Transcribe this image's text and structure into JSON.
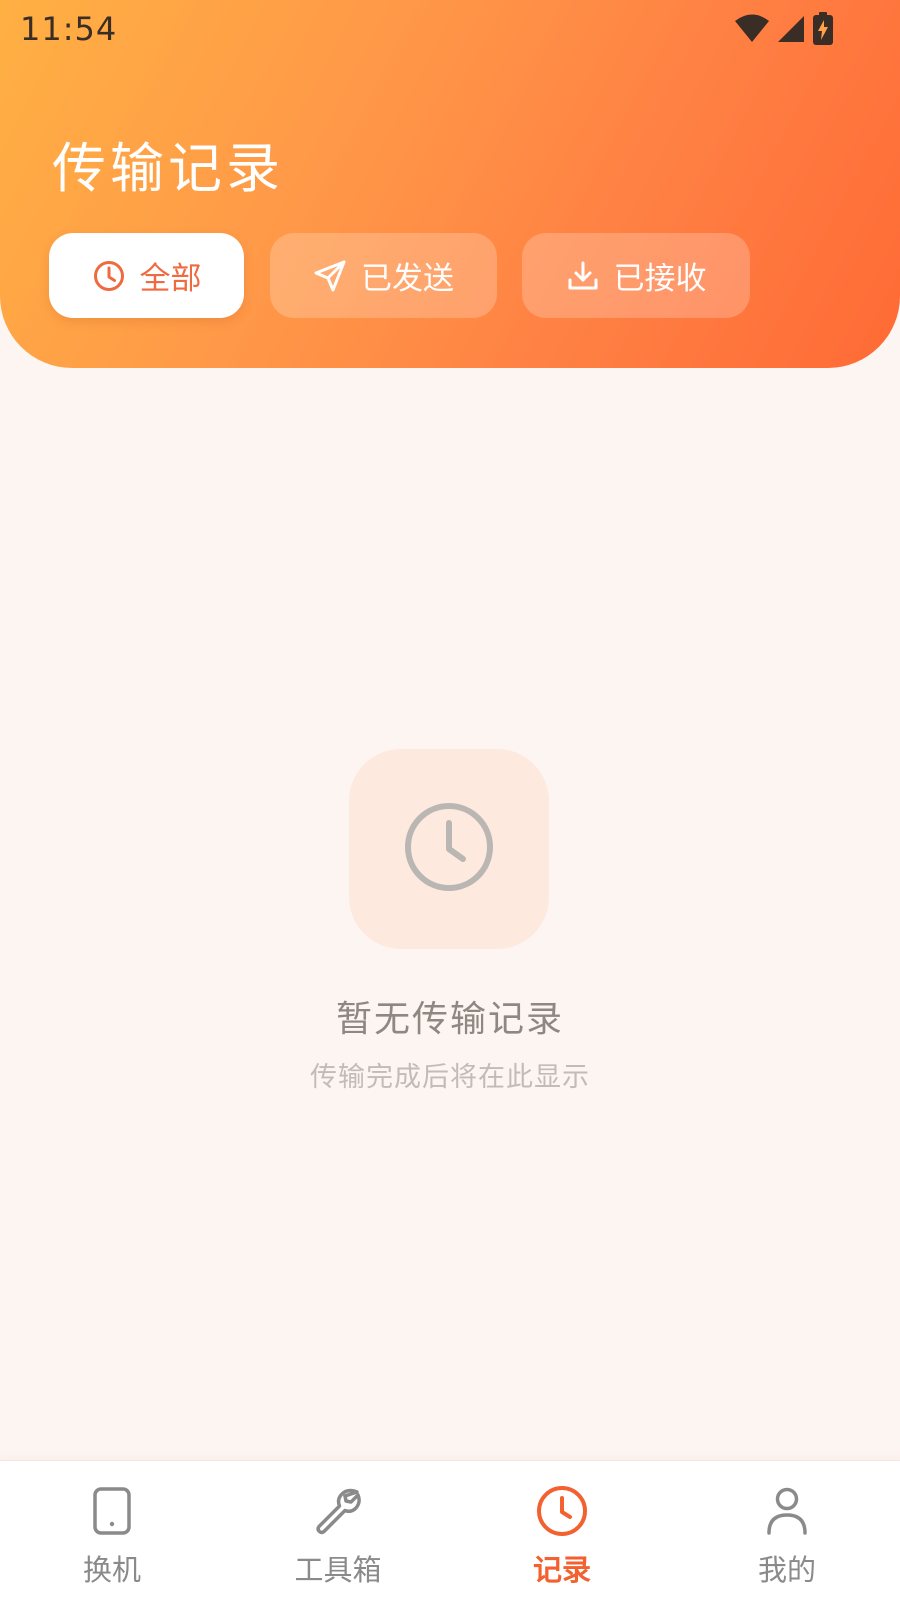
{
  "status_bar": {
    "time": "11:54",
    "icons": [
      "wifi-icon",
      "signal-icon",
      "battery-charging-icon"
    ]
  },
  "header": {
    "title": "传输记录",
    "tabs": [
      {
        "label": "全部",
        "icon": "clock-icon",
        "selected": true
      },
      {
        "label": "已发送",
        "icon": "send-icon",
        "selected": false
      },
      {
        "label": "已接收",
        "icon": "download-icon",
        "selected": false
      }
    ]
  },
  "empty_state": {
    "icon": "clock-icon",
    "title": "暂无传输记录",
    "subtitle": "传输完成后将在此显示"
  },
  "bottom_nav": {
    "items": [
      {
        "label": "换机",
        "icon": "phone-icon",
        "active": false
      },
      {
        "label": "工具箱",
        "icon": "wrench-icon",
        "active": false
      },
      {
        "label": "记录",
        "icon": "clock-icon",
        "active": true
      },
      {
        "label": "我的",
        "icon": "user-icon",
        "active": false
      }
    ]
  },
  "colors": {
    "header_gradient_start": "#ffb043",
    "header_gradient_end": "#ff6a35",
    "accent": "#f2612f",
    "background": "#fdf5f1"
  }
}
